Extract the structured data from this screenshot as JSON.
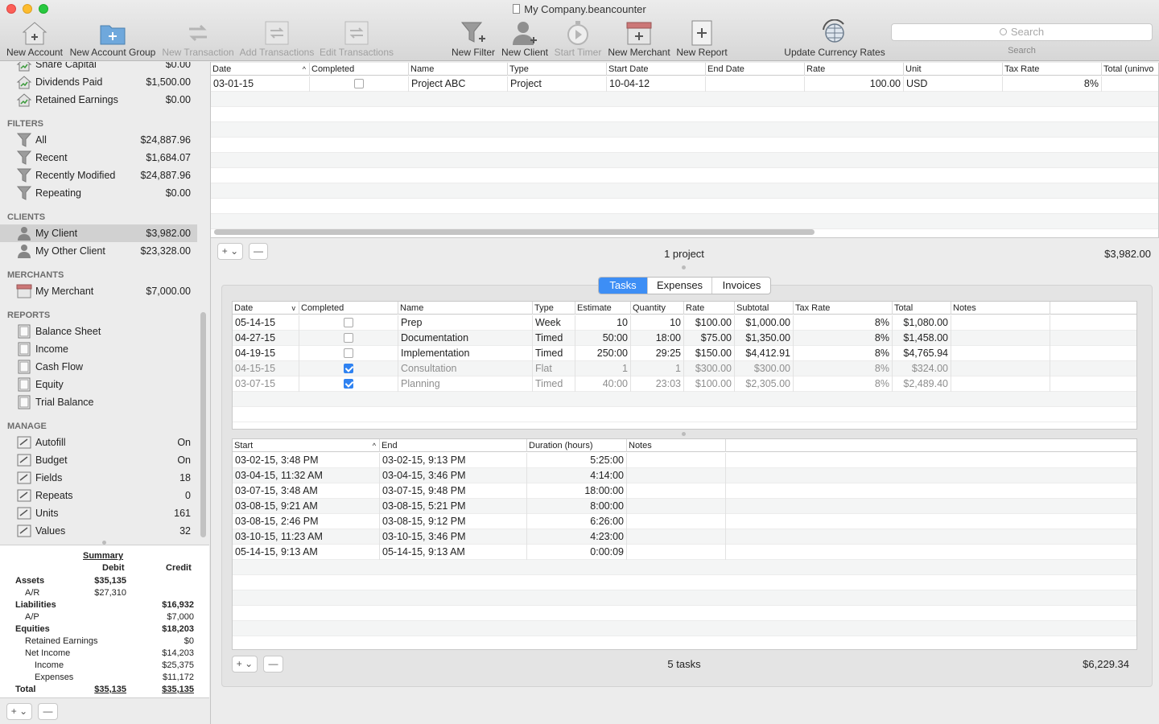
{
  "window": {
    "title": "My Company.beancounter"
  },
  "toolbar": {
    "new_account": "New Account",
    "new_account_group": "New Account Group",
    "new_transaction": "New Transaction",
    "add_transactions": "Add Transactions",
    "edit_transactions": "Edit Transactions",
    "new_filter": "New Filter",
    "new_client": "New Client",
    "start_timer": "Start Timer",
    "new_merchant": "New Merchant",
    "new_report": "New Report",
    "update_currency_rates": "Update Currency Rates",
    "search_placeholder": "Search",
    "search_label": "Search"
  },
  "sidebar": {
    "equity_items": [
      {
        "name": "Share Capital",
        "value": "$0.00"
      },
      {
        "name": "Dividends Paid",
        "value": "$1,500.00"
      },
      {
        "name": "Retained Earnings",
        "value": "$0.00"
      }
    ],
    "filters_heading": "FILTERS",
    "filters": [
      {
        "name": "All",
        "value": "$24,887.96"
      },
      {
        "name": "Recent",
        "value": "$1,684.07"
      },
      {
        "name": "Recently Modified",
        "value": "$24,887.96"
      },
      {
        "name": "Repeating",
        "value": "$0.00"
      }
    ],
    "clients_heading": "CLIENTS",
    "clients": [
      {
        "name": "My Client",
        "value": "$3,982.00"
      },
      {
        "name": "My Other Client",
        "value": "$23,328.00"
      }
    ],
    "merchants_heading": "MERCHANTS",
    "merchants": [
      {
        "name": "My Merchant",
        "value": "$7,000.00"
      }
    ],
    "reports_heading": "REPORTS",
    "reports": [
      {
        "name": "Balance Sheet"
      },
      {
        "name": "Income"
      },
      {
        "name": "Cash Flow"
      },
      {
        "name": "Equity"
      },
      {
        "name": "Trial Balance"
      }
    ],
    "manage_heading": "MANAGE",
    "manage": [
      {
        "name": "Autofill",
        "value": "On"
      },
      {
        "name": "Budget",
        "value": "On"
      },
      {
        "name": "Fields",
        "value": "18"
      },
      {
        "name": "Repeats",
        "value": "0"
      },
      {
        "name": "Units",
        "value": "161"
      },
      {
        "name": "Values",
        "value": "32"
      }
    ]
  },
  "summary": {
    "title": "Summary",
    "debit_label": "Debit",
    "credit_label": "Credit",
    "rows": [
      {
        "label": "Assets",
        "debit": "$35,135",
        "credit": "",
        "bold": true,
        "indent": 0
      },
      {
        "label": "A/R",
        "debit": "$27,310",
        "credit": "",
        "bold": false,
        "indent": 1
      },
      {
        "label": "Liabilities",
        "debit": "",
        "credit": "$16,932",
        "bold": true,
        "indent": 0
      },
      {
        "label": "A/P",
        "debit": "",
        "credit": "$7,000",
        "bold": false,
        "indent": 1
      },
      {
        "label": "Equities",
        "debit": "",
        "credit": "$18,203",
        "bold": true,
        "indent": 0
      },
      {
        "label": "Retained Earnings",
        "debit": "",
        "credit": "$0",
        "bold": false,
        "indent": 1
      },
      {
        "label": "Net Income",
        "debit": "",
        "credit": "$14,203",
        "bold": false,
        "indent": 1
      },
      {
        "label": "Income",
        "debit": "",
        "credit": "$25,375",
        "bold": false,
        "indent": 2
      },
      {
        "label": "Expenses",
        "debit": "",
        "credit": "$11,172",
        "bold": false,
        "indent": 2
      },
      {
        "label": "Total",
        "debit": "$35,135",
        "credit": "$35,135",
        "bold": true,
        "indent": 0
      }
    ]
  },
  "projects": {
    "columns": [
      "Date",
      "Completed",
      "Name",
      "Type",
      "Start Date",
      "End Date",
      "Rate",
      "Unit",
      "Tax Rate",
      "Total (uninvo"
    ],
    "rows": [
      {
        "date": "03-01-15",
        "completed": false,
        "name": "Project ABC",
        "type": "Project",
        "start": "10-04-12",
        "end": "",
        "rate": "100.00",
        "unit": "USD",
        "tax": "8%",
        "total": "$"
      }
    ],
    "status": "1 project",
    "total": "$3,982.00"
  },
  "tabs": [
    "Tasks",
    "Expenses",
    "Invoices"
  ],
  "tasks": {
    "columns": [
      "Date",
      "Completed",
      "Name",
      "Type",
      "Estimate",
      "Quantity",
      "Rate",
      "Subtotal",
      "Tax Rate",
      "Total",
      "Notes"
    ],
    "rows": [
      {
        "date": "05-14-15",
        "completed": false,
        "name": "Prep",
        "type": "Week",
        "estimate": "10",
        "quantity": "10",
        "rate": "$100.00",
        "subtotal": "$1,000.00",
        "tax": "8%",
        "total": "$1,080.00",
        "notes": ""
      },
      {
        "date": "04-27-15",
        "completed": false,
        "name": "Documentation",
        "type": "Timed",
        "estimate": "50:00",
        "quantity": "18:00",
        "rate": "$75.00",
        "subtotal": "$1,350.00",
        "tax": "8%",
        "total": "$1,458.00",
        "notes": ""
      },
      {
        "date": "04-19-15",
        "completed": false,
        "name": "Implementation",
        "type": "Timed",
        "estimate": "250:00",
        "quantity": "29:25",
        "rate": "$150.00",
        "subtotal": "$4,412.91",
        "tax": "8%",
        "total": "$4,765.94",
        "notes": ""
      },
      {
        "date": "04-15-15",
        "completed": true,
        "name": "Consultation",
        "type": "Flat",
        "estimate": "1",
        "quantity": "1",
        "rate": "$300.00",
        "subtotal": "$300.00",
        "tax": "8%",
        "total": "$324.00",
        "notes": ""
      },
      {
        "date": "03-07-15",
        "completed": true,
        "name": "Planning",
        "type": "Timed",
        "estimate": "40:00",
        "quantity": "23:03",
        "rate": "$100.00",
        "subtotal": "$2,305.00",
        "tax": "8%",
        "total": "$2,489.40",
        "notes": ""
      }
    ],
    "status": "5 tasks",
    "total": "$6,229.34"
  },
  "timers": {
    "columns": [
      "Start",
      "End",
      "Duration (hours)",
      "Notes"
    ],
    "rows": [
      {
        "start": "03-02-15, 3:48 PM",
        "end": "03-02-15, 9:13 PM",
        "duration": "5:25:00",
        "notes": ""
      },
      {
        "start": "03-04-15, 11:32 AM",
        "end": "03-04-15, 3:46 PM",
        "duration": "4:14:00",
        "notes": ""
      },
      {
        "start": "03-07-15, 3:48 AM",
        "end": "03-07-15, 9:48 PM",
        "duration": "18:00:00",
        "notes": ""
      },
      {
        "start": "03-08-15, 9:21 AM",
        "end": "03-08-15, 5:21 PM",
        "duration": "8:00:00",
        "notes": ""
      },
      {
        "start": "03-08-15, 2:46 PM",
        "end": "03-08-15, 9:12 PM",
        "duration": "6:26:00",
        "notes": ""
      },
      {
        "start": "03-10-15, 11:23 AM",
        "end": "03-10-15, 3:46 PM",
        "duration": "4:23:00",
        "notes": ""
      },
      {
        "start": "05-14-15, 9:13 AM",
        "end": "05-14-15, 9:13 AM",
        "duration": "0:00:09",
        "notes": ""
      }
    ]
  },
  "controls": {
    "add": "+ ⌄",
    "remove": "—"
  }
}
